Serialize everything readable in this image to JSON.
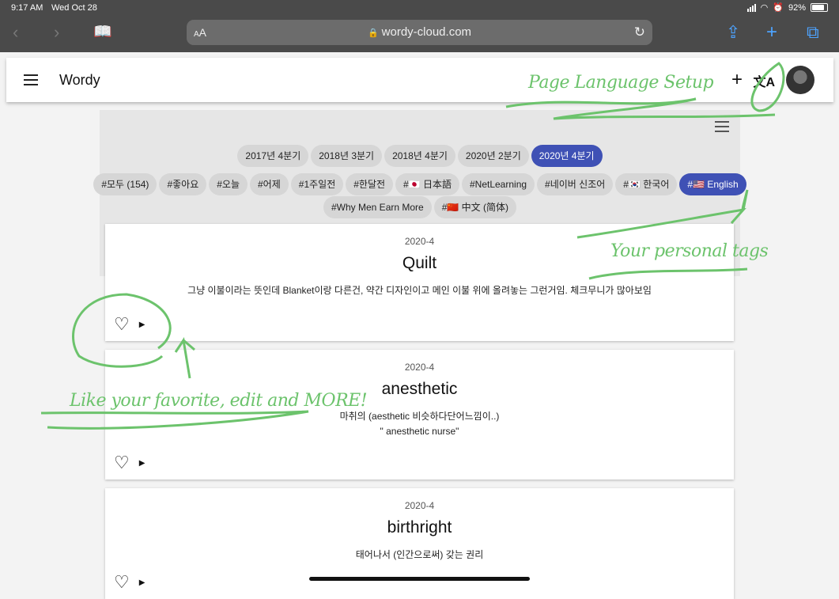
{
  "status_bar": {
    "time": "9:17 AM",
    "date": "Wed Oct 28",
    "battery": "92%"
  },
  "browser": {
    "aa_label": "AA",
    "url": "wordy-cloud.com"
  },
  "app": {
    "title": "Wordy"
  },
  "period_tabs": [
    "2017년 4분기",
    "2018년 3분기",
    "2018년 4분기",
    "2020년 2분기",
    "2020년 4분기"
  ],
  "active_period": "2020년 4분기",
  "tags_row1": [
    "#모두 (154)",
    "#좋아요",
    "#오늘",
    "#어제",
    "#1주일전",
    "#한달전",
    "#🇯🇵 日本語",
    "#NetLearning",
    "#네이버 신조어",
    "#🇰🇷 한국어",
    "#🇺🇸 English"
  ],
  "tags_row2": [
    "#Why Men Earn More",
    "#🇨🇳 中文 (简体)"
  ],
  "active_tag": "#🇺🇸 English",
  "cards": [
    {
      "period": "2020-4",
      "word": "Quilt",
      "definition": "그냥 이불이라는 뜻인데 Blanket이랑 다른건, 약간 디자인이고 메인 이불 위에 올려놓는 그런거임. 체크무니가 많아보임"
    },
    {
      "period": "2020-4",
      "word": "anesthetic",
      "definition": "마취의 (aesthetic 비슷하다단어느낌이..)\n\" anesthetic nurse\""
    },
    {
      "period": "2020-4",
      "word": "birthright",
      "definition": "태어나서 (인간으로써) 갖는 권리"
    }
  ],
  "annotations": {
    "page_language": "Page Language Setup",
    "personal_tags": "Your personal tags",
    "like_edit": "Like your favorite, edit and MORE!"
  },
  "colors": {
    "accent": "#3f51b5",
    "annotation": "#6cc36c",
    "browser_bar": "#4a4a4a"
  }
}
